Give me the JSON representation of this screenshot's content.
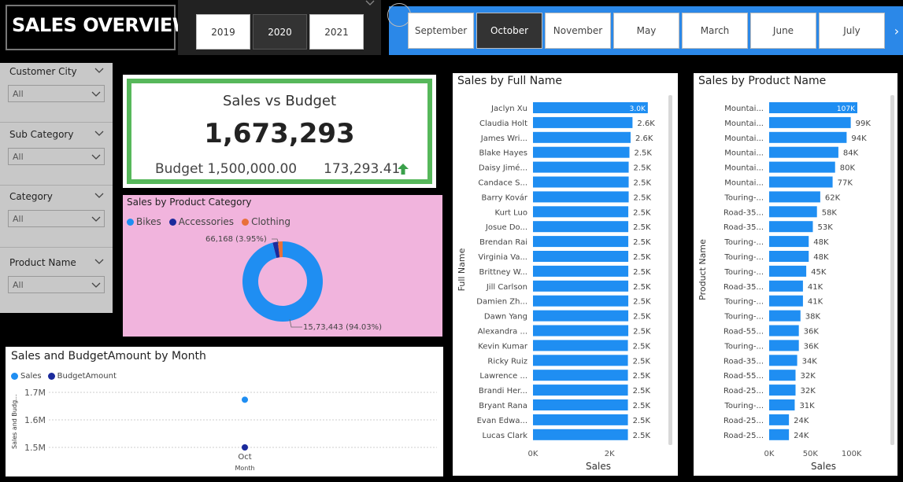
{
  "header": {
    "title": "SALES OVERVIEW"
  },
  "year_slicer": {
    "options": [
      "2019",
      "2020",
      "2021"
    ],
    "selected": "2020"
  },
  "month_slicer": {
    "options": [
      "September",
      "October",
      "November",
      "May",
      "March",
      "June",
      "July"
    ],
    "selected": "October",
    "next_icon": "chevron-right-icon"
  },
  "filters": [
    {
      "label": "Customer City",
      "value": "All"
    },
    {
      "label": "Sub Category",
      "value": "All"
    },
    {
      "label": "Category",
      "value": "All"
    },
    {
      "label": "Product Name",
      "value": "All"
    }
  ],
  "kpi": {
    "title": "Sales vs Budget",
    "value": "1,673,293",
    "budget_text": "Budget 1,500,000.00",
    "difference": "173,293.41",
    "trend_icon": "arrow-up-icon",
    "border_color": "#57b85b",
    "trend_color": "#3aa04a"
  },
  "colors": {
    "accent": "#2b88e8",
    "bar": "#1f8ef2",
    "accessories": "#1b2a9c",
    "clothing": "#e8703a",
    "donut_bg": "#f1b4dd"
  },
  "chart_data": [
    {
      "type": "pie",
      "donut": true,
      "title": "Sales by Product Category",
      "legend": [
        "Bikes",
        "Accessories",
        "Clothing"
      ],
      "legend_position": "top-left",
      "slices": [
        {
          "name": "Bikes",
          "value": 1573443,
          "percent": 94.03,
          "color": "#1f8ef2"
        },
        {
          "name": "Accessories",
          "value": 34682,
          "percent": 2.07,
          "color": "#1b2a9c"
        },
        {
          "name": "Clothing",
          "value": 31500,
          "percent": 1.88,
          "color": "#e8703a"
        }
      ],
      "data_labels": [
        "66,168 (3.95%)",
        "15,73,443 (94.03%)"
      ]
    },
    {
      "type": "scatter",
      "title": "Sales and BudgetAmount by Month",
      "legend": [
        "Sales",
        "BudgetAmount"
      ],
      "legend_position": "top-left",
      "xlabel": "Month",
      "ylabel": "Sales and Budg...",
      "categories": [
        "Oct"
      ],
      "ylim": [
        1500000,
        1700000
      ],
      "yticks": [
        "1.7M",
        "1.6M",
        "1.5M"
      ],
      "grid": true,
      "series": [
        {
          "name": "Sales",
          "values": [
            1673293
          ],
          "color": "#1f8ef2"
        },
        {
          "name": "BudgetAmount",
          "values": [
            1500000
          ],
          "color": "#1b2a9c"
        }
      ]
    },
    {
      "type": "bar",
      "orientation": "horizontal",
      "title": "Sales by Full Name",
      "xlabel": "Sales",
      "ylabel": "Full Name",
      "xlim": [
        0,
        3000
      ],
      "xticks": [
        "0K",
        "2K"
      ],
      "xtick_values": [
        0,
        2000
      ],
      "categories": [
        "Jaclyn Xu",
        "Claudia Holt",
        "James Wri...",
        "Blake Hayes",
        "Daisy Jimé...",
        "Candace S...",
        "Barry Kovár",
        "Kurt Luo",
        "Josue Do...",
        "Brendan Rai",
        "Virginia Va...",
        "Brittney W...",
        "Jill Carlson",
        "Damien Zh...",
        "Dawn Yang",
        "Alexandra ...",
        "Kevin Kumar",
        "Ricky Ruiz",
        "Lawrence ...",
        "Brandi Her...",
        "Bryant Rana",
        "Evan Edwa...",
        "Lucas Clark"
      ],
      "values": [
        3000,
        2600,
        2550,
        2520,
        2500,
        2500,
        2500,
        2490,
        2490,
        2490,
        2490,
        2490,
        2490,
        2490,
        2490,
        2490,
        2480,
        2480,
        2480,
        2480,
        2480,
        2480,
        2480
      ],
      "data_labels": [
        "3.0K",
        "2.6K",
        "2.6K",
        "2.5K",
        "2.5K",
        "2.5K",
        "2.5K",
        "2.5K",
        "2.5K",
        "2.5K",
        "2.5K",
        "2.5K",
        "2.5K",
        "2.5K",
        "2.5K",
        "2.5K",
        "2.5K",
        "2.5K",
        "2.5K",
        "2.5K",
        "2.5K",
        "2.5K",
        "2.5K"
      ]
    },
    {
      "type": "bar",
      "orientation": "horizontal",
      "title": "Sales by Product Name",
      "xlabel": "Sales",
      "ylabel": "Product Name",
      "xlim": [
        0,
        107000
      ],
      "xticks": [
        "0K",
        "50K",
        "100K"
      ],
      "xtick_values": [
        0,
        50000,
        100000
      ],
      "categories": [
        "Mountai...",
        "Mountai...",
        "Mountai...",
        "Mountai...",
        "Mountai...",
        "Mountai...",
        "Touring-...",
        "Road-35...",
        "Road-35...",
        "Touring-...",
        "Touring-...",
        "Touring-...",
        "Road-35...",
        "Touring-...",
        "Touring-...",
        "Road-55...",
        "Touring-...",
        "Road-35...",
        "Road-55...",
        "Road-25...",
        "Touring-...",
        "Road-25...",
        "Road-25..."
      ],
      "values": [
        107000,
        99000,
        94000,
        84000,
        80000,
        77000,
        62000,
        58000,
        53000,
        48000,
        48000,
        45000,
        41000,
        41000,
        38000,
        36000,
        36000,
        34000,
        32000,
        32000,
        31000,
        24000,
        24000
      ],
      "data_labels": [
        "107K",
        "99K",
        "94K",
        "84K",
        "80K",
        "77K",
        "62K",
        "58K",
        "53K",
        "48K",
        "48K",
        "45K",
        "41K",
        "41K",
        "38K",
        "36K",
        "36K",
        "34K",
        "32K",
        "32K",
        "31K",
        "24K",
        "24K"
      ]
    }
  ]
}
